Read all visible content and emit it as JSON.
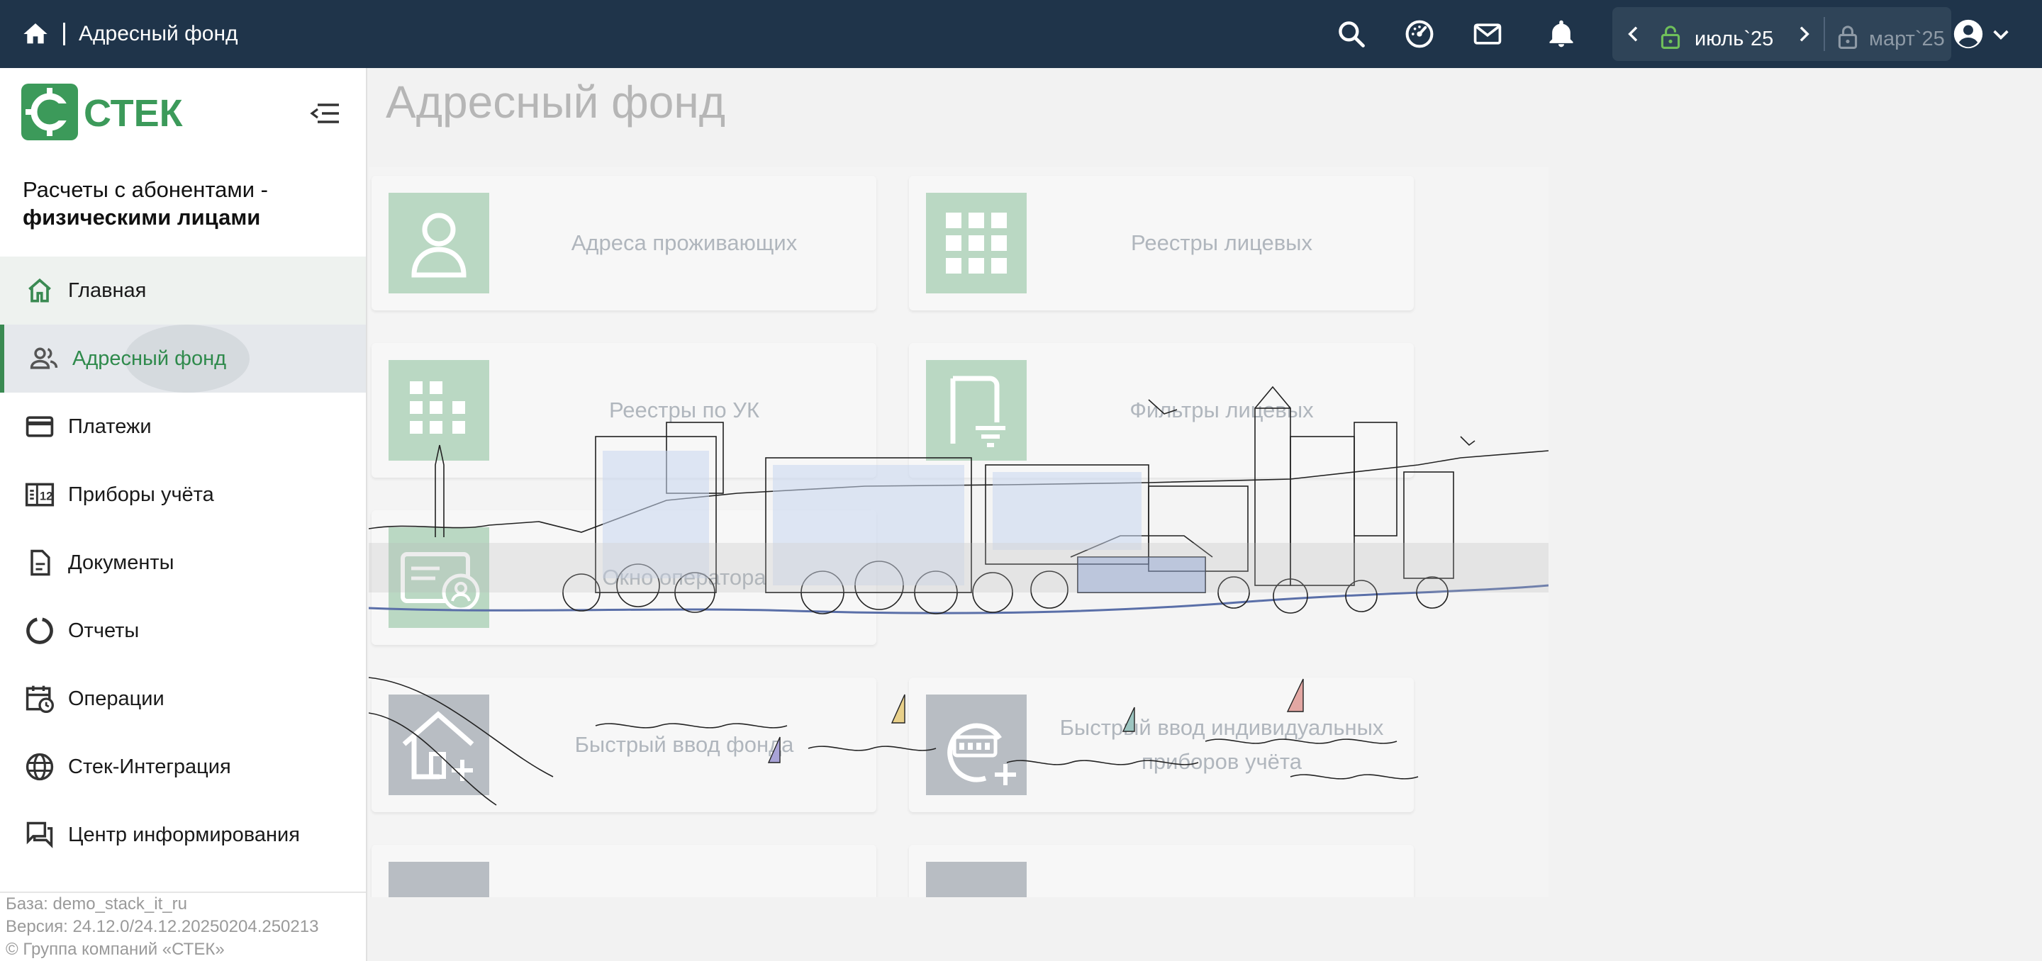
{
  "topbar": {
    "title": "Адресный фонд",
    "current_period": "июль`25",
    "closed_period": "март`25"
  },
  "icons": {
    "home": "home-icon",
    "search": "search-icon",
    "dashboard": "speedometer-icon",
    "mail": "mail-icon",
    "notifications": "bell-icon",
    "user": "account-circle-icon"
  },
  "sidebar": {
    "logo_text": "СТЕК",
    "app_title_line1": "Расчеты с абонентами -",
    "app_title_line2": "физическими лицами",
    "items": [
      {
        "label": "Главная",
        "icon": "home-outline-icon"
      },
      {
        "label": "Адресный фонд",
        "icon": "people-icon",
        "active": true
      },
      {
        "label": "Платежи",
        "icon": "credit-card-icon"
      },
      {
        "label": "Приборы учёта",
        "icon": "meter-icon"
      },
      {
        "label": "Документы",
        "icon": "document-icon"
      },
      {
        "label": "Отчеты",
        "icon": "chart-ring-icon"
      },
      {
        "label": "Операции",
        "icon": "calendar-clock-icon"
      },
      {
        "label": "Стек-Интеграция",
        "icon": "globe-icon"
      },
      {
        "label": "Центр информирования",
        "icon": "forum-icon"
      }
    ],
    "footer": {
      "base": "База: demo_stack_it_ru",
      "version": "Версия: 24.12.0/24.12.20250204.250213",
      "copyright": "© Группа компаний «СТЕК»"
    }
  },
  "main": {
    "page_title": "Адресный фонд",
    "cards": [
      {
        "label": "Адреса проживающих",
        "icon": "person-icon"
      },
      {
        "label": "Реестры лицевых",
        "icon": "grid-icon"
      },
      {
        "label": "Реестры по УК",
        "icon": "building-icon"
      },
      {
        "label": "Фильтры лицевых",
        "icon": "filter-list-icon"
      },
      {
        "label": "Окно оператора",
        "icon": "operator-card-icon"
      },
      {
        "label": "Быстрый ввод фонда",
        "icon": "house-add-icon"
      },
      {
        "label": "Быстрый ввод индивидуальных приборов учёта",
        "icon": "meter-add-icon"
      }
    ]
  },
  "colors": {
    "topbar": "#1f344a",
    "accent": "#3a8a52",
    "tile_green": "#bad8c3",
    "tile_grey": "#b8bdc3"
  }
}
